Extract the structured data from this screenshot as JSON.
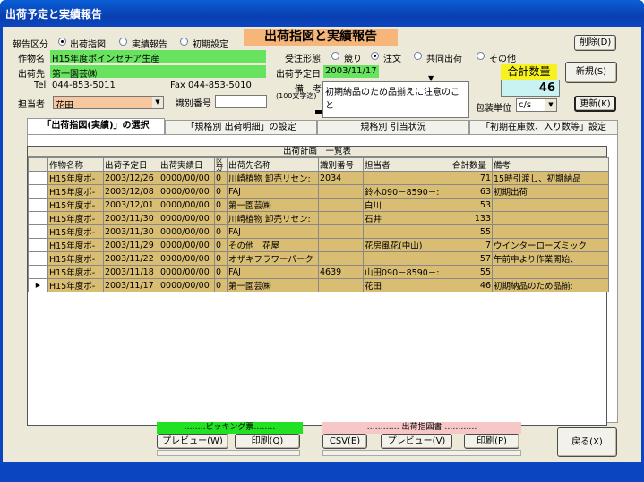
{
  "window_title": "出荷予定と実績報告",
  "header_title": "出荷指図と実績報告",
  "report_type": {
    "label": "報告区分",
    "options": [
      "出荷指図",
      "実績報告",
      "初期設定"
    ],
    "selected": 0
  },
  "crop": {
    "label": "作物名",
    "value": "H15年度ポインセチア生産"
  },
  "shipto": {
    "label": "出荷先",
    "value": "第一園芸㈱"
  },
  "tel": {
    "label": "Tel",
    "value": "044-853-5011"
  },
  "fax": {
    "label": "Fax",
    "value": "044-853-5010"
  },
  "staff": {
    "label": "担当者",
    "value": "花田"
  },
  "idno": {
    "label": "識別番号",
    "value": ""
  },
  "order_type": {
    "label": "受注形態",
    "options": [
      "競り",
      "注文",
      "共同出荷",
      "その他"
    ],
    "selected": 1
  },
  "ship_date": {
    "label": "出荷予定日",
    "value": "2003/11/17"
  },
  "remarks": {
    "label": "備　考",
    "sublabel": "(100文字迄)",
    "value": "初期納品のため品揃えに注意のこと"
  },
  "total": {
    "label": "合計数量",
    "value": "46"
  },
  "unit": {
    "label": "包装単位",
    "value": "c/s"
  },
  "buttons": {
    "delete": "削除(D)",
    "new": "新規(S)",
    "update": "更新(K)",
    "back": "戻る(X)"
  },
  "tabs": [
    "「出荷指図(実績)」の選択",
    "「規格別 出荷明細」の設定",
    "規格別 引当状況",
    "「初期在庫数、入り数等」設定"
  ],
  "grid": {
    "title": "出荷計画　一覧表",
    "columns": [
      "作物名称",
      "出荷予定日",
      "出荷実績日",
      "区分",
      "出荷先名称",
      "識別番号",
      "担当者",
      "合計数量",
      "備考"
    ],
    "rows": [
      [
        "H15年度ポ-",
        "2003/12/26",
        "0000/00/00",
        "0",
        "川崎植物 卸売リセン:",
        "2034",
        "",
        "71",
        "15時引渡し、初期納品"
      ],
      [
        "H15年度ポ-",
        "2003/12/08",
        "0000/00/00",
        "0",
        "FAJ",
        "",
        "鈴木090－8590－:",
        "63",
        "初期出荷"
      ],
      [
        "H15年度ポ-",
        "2003/12/01",
        "0000/00/00",
        "0",
        "第一園芸㈱",
        "",
        "白川",
        "53",
        ""
      ],
      [
        "H15年度ポ-",
        "2003/11/30",
        "0000/00/00",
        "0",
        "川崎植物 卸売リセン:",
        "",
        "石井",
        "133",
        ""
      ],
      [
        "H15年度ポ-",
        "2003/11/30",
        "0000/00/00",
        "0",
        "FAJ",
        "",
        "",
        "55",
        ""
      ],
      [
        "H15年度ポ-",
        "2003/11/29",
        "0000/00/00",
        "0",
        "その他　花屋",
        "",
        "花房風花(中山)",
        "7",
        "ウインターローズミック"
      ],
      [
        "H15年度ポ-",
        "2003/11/22",
        "0000/00/00",
        "0",
        "オザキフラワーパーク",
        "",
        "",
        "57",
        "午前中より作業開始、"
      ],
      [
        "H15年度ポ-",
        "2003/11/18",
        "0000/00/00",
        "0",
        "FAJ",
        "4639",
        "山田090－8590－:",
        "55",
        ""
      ],
      [
        "H15年度ポ-",
        "2003/11/17",
        "0000/00/00",
        "0",
        "第一園芸㈱",
        "",
        "花田",
        "46",
        "初期納品のため品揃:"
      ]
    ],
    "current_row": 8,
    "row_marker": "▶"
  },
  "picking": {
    "label": "‥‥‥‥ピッキング票‥‥‥‥",
    "preview": "プレビュー(W)",
    "print": "印刷(Q)"
  },
  "instruction": {
    "label": "‥‥‥‥‥‥ 出荷指図書 ‥‥‥‥‥‥",
    "csv": "CSV(E)",
    "preview": "プレビュー(V)",
    "print": "印刷(P)"
  },
  "colors": {
    "title_bar": "#0a5fd8",
    "field_green": "#67e35f",
    "row_fill": "#d8bd72",
    "header_orange": "#f7b679",
    "total_yellow": "#f6f21f",
    "picking_green": "#22e022",
    "instruction_pink": "#f7c7c7"
  }
}
